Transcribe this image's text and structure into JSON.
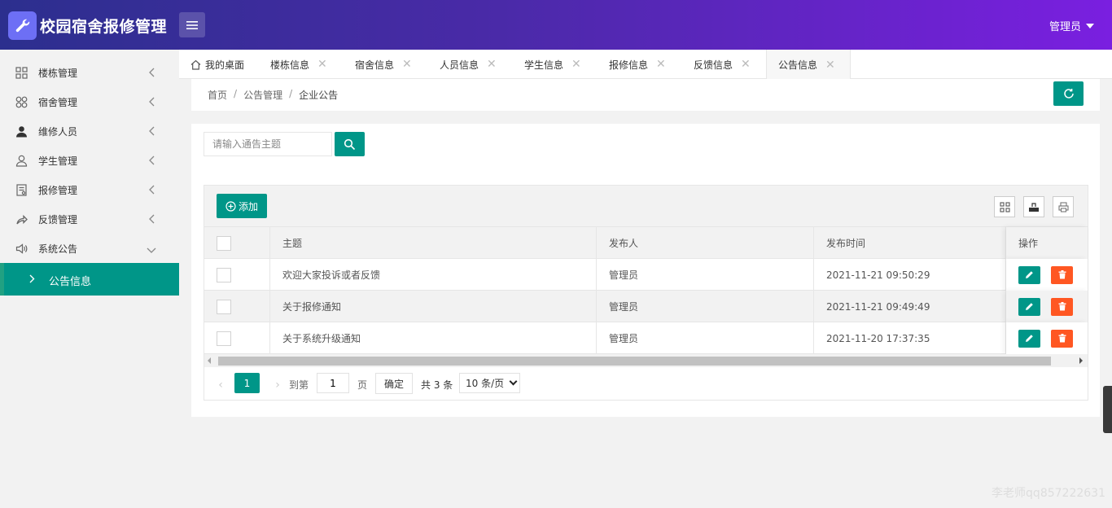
{
  "app": {
    "title": "校园宿舍报修管理",
    "user": "管理员"
  },
  "sidebar": {
    "items": [
      {
        "label": "楼栋管理",
        "icon": "grid-icon"
      },
      {
        "label": "宿舍管理",
        "icon": "clover-icon"
      },
      {
        "label": "维修人员",
        "icon": "user-solid-icon"
      },
      {
        "label": "学生管理",
        "icon": "user-outline-icon"
      },
      {
        "label": "报修管理",
        "icon": "form-icon"
      },
      {
        "label": "反馈管理",
        "icon": "share-icon"
      },
      {
        "label": "系统公告",
        "icon": "speaker-icon"
      }
    ],
    "active_sub": "公告信息"
  },
  "tabs": [
    {
      "label": "我的桌面"
    },
    {
      "label": "楼栋信息"
    },
    {
      "label": "宿舍信息"
    },
    {
      "label": "人员信息"
    },
    {
      "label": "学生信息"
    },
    {
      "label": "报修信息"
    },
    {
      "label": "反馈信息"
    },
    {
      "label": "公告信息"
    }
  ],
  "tab_close_glyph": "✕",
  "breadcrumb": {
    "home": "首页",
    "sep": "/",
    "section": "公告管理",
    "current": "企业公告"
  },
  "search": {
    "placeholder": "请输入通告主题"
  },
  "toolbar": {
    "add_label": "添加"
  },
  "table": {
    "columns": [
      "主题",
      "发布人",
      "发布时间",
      "操作"
    ],
    "rows": [
      {
        "title": "欢迎大家投诉或者反馈",
        "publisher": "管理员",
        "time": "2021-11-21 09:50:29"
      },
      {
        "title": "关于报修通知",
        "publisher": "管理员",
        "time": "2021-11-21 09:49:49"
      },
      {
        "title": "关于系统升级通知",
        "publisher": "管理员",
        "time": "2021-11-20 17:37:35"
      }
    ]
  },
  "pager": {
    "current_page": "1",
    "goto_label": "到第",
    "page_input": "1",
    "page_unit": "页",
    "confirm": "确定",
    "total": "共 3 条",
    "page_size": "10 条/页"
  },
  "watermark": "李老师qq857222631",
  "colors": {
    "primary": "#009688",
    "danger": "#ff5722",
    "header_start": "#2c2f8e",
    "header_end": "#7a1fe0"
  }
}
